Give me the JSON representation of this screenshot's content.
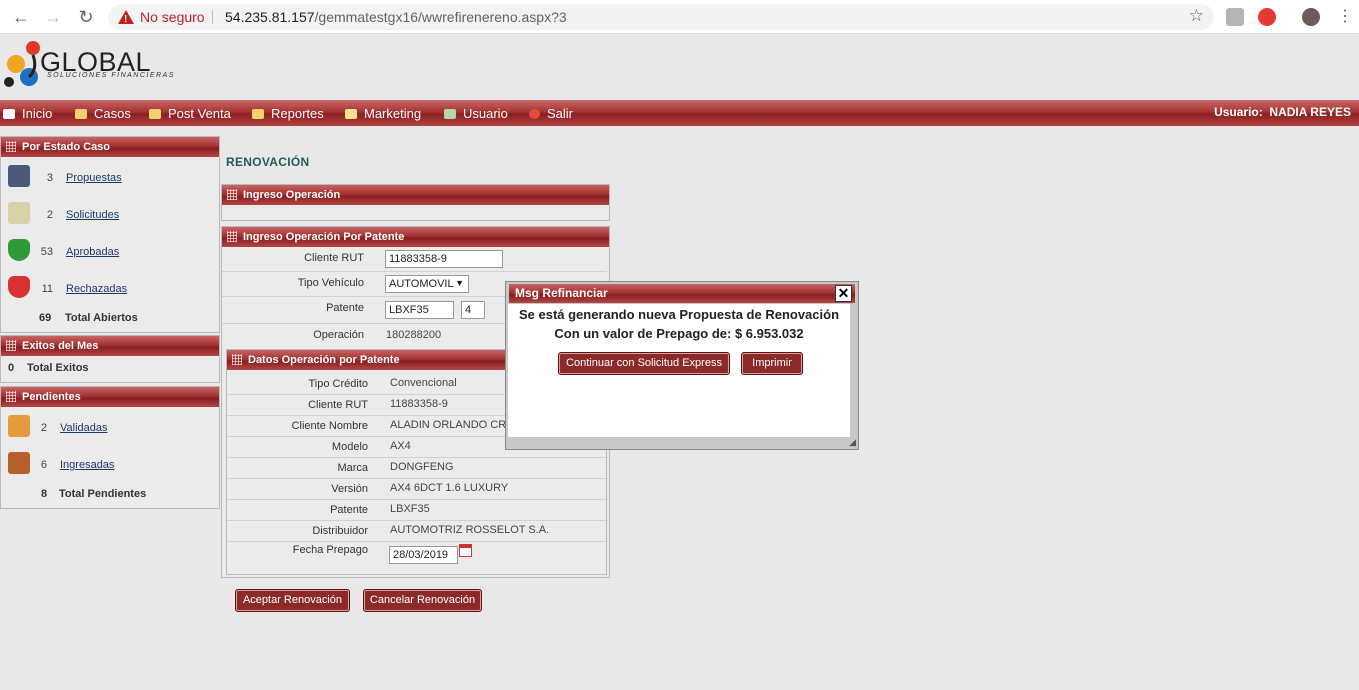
{
  "browser": {
    "security_label": "No seguro",
    "url_host": "54.235.81.157",
    "url_path": "/gemmatestgx16/wwrefirenereno.aspx?3"
  },
  "logo": {
    "title": "GLOBAL",
    "subtitle": "SOLUCIONES FINANCIERAS"
  },
  "menu": {
    "items": [
      {
        "label": "Inicio",
        "icon": "home-icon"
      },
      {
        "label": "Casos",
        "icon": "folder-icon"
      },
      {
        "label": "Post Venta",
        "icon": "folder-icon"
      },
      {
        "label": "Reportes",
        "icon": "folder-icon"
      },
      {
        "label": "Marketing",
        "icon": "envelope-icon"
      },
      {
        "label": "Usuario",
        "icon": "user-icon"
      },
      {
        "label": "Salir",
        "icon": "exit-icon"
      }
    ],
    "user_label": "Usuario:",
    "user_name": "NADIA REYES"
  },
  "sidebar": {
    "estado": {
      "header": "Por Estado Caso",
      "items": [
        {
          "count": "3",
          "label": "Propuestas",
          "icon": "calculator-icon"
        },
        {
          "count": "2",
          "label": "Solicitudes",
          "icon": "document-icon"
        },
        {
          "count": "53",
          "label": "Aprobadas",
          "icon": "check-shield-icon"
        },
        {
          "count": "11",
          "label": "Rechazadas",
          "icon": "reject-shield-icon"
        }
      ],
      "total_count": "69",
      "total_label": "Total Abiertos"
    },
    "exitos": {
      "header": "Exitos del Mes",
      "total_count": "0",
      "total_label": "Total Exitos"
    },
    "pendientes": {
      "header": "Pendientes",
      "items": [
        {
          "count": "2",
          "label": "Validadas",
          "icon": "folder-doc-icon"
        },
        {
          "count": "6",
          "label": "Ingresadas",
          "icon": "boxes-icon"
        }
      ],
      "total_count": "8",
      "total_label": "Total Pendientes"
    }
  },
  "main": {
    "title": "RENOVACIÓN",
    "ingreso_header": "Ingreso Operación",
    "patente_header": "Ingreso Operación Por Patente",
    "patente_form": {
      "cliente_rut_label": "Cliente RUT",
      "cliente_rut_value": "11883358-9",
      "tipo_vehiculo_label": "Tipo Vehículo",
      "tipo_vehiculo_value": "AUTOMOVIL",
      "patente_label": "Patente",
      "patente_value": "LBXF35",
      "patente_dv": "4",
      "operacion_label": "Operación",
      "operacion_value": "180288200"
    },
    "datos_header": "Datos Operación por Patente",
    "datos": [
      {
        "label": "Tipo Crédito",
        "value": "Convencional"
      },
      {
        "label": "Cliente RUT",
        "value": "11883358-9"
      },
      {
        "label": "Cliente Nombre",
        "value": "ALADIN ORLANDO CRUZ"
      },
      {
        "label": "Modelo",
        "value": "AX4"
      },
      {
        "label": "Marca",
        "value": "DONGFENG"
      },
      {
        "label": "Versión",
        "value": "AX4 6DCT 1.6 LUXURY"
      },
      {
        "label": "Patente",
        "value": "LBXF35"
      },
      {
        "label": "Distribuidor",
        "value": "AUTOMOTRIZ ROSSELOT S.A."
      }
    ],
    "fecha_label": "Fecha Prepago",
    "fecha_value": "28/03/2019",
    "aceptar_label": "Aceptar Renovación",
    "cancelar_label": "Cancelar Renovación"
  },
  "modal": {
    "title": "Msg Refinanciar",
    "close": "X",
    "line1": "Se está generando nueva Propuesta de Renovación",
    "line2": "Con un valor de Prepago de: $ 6.953.032",
    "continuar_label": "Continuar con Solicitud Express",
    "imprimir_label": "Imprimir"
  },
  "colors": {
    "accent": "#9e2c2c",
    "title": "#1f5c5c",
    "link": "#1a3a6a"
  }
}
